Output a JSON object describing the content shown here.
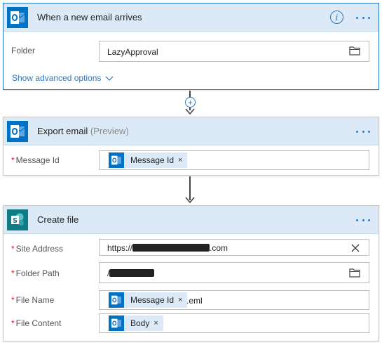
{
  "trigger": {
    "title": "When a new email arrives",
    "info_glyph": "i",
    "folder_label": "Folder",
    "folder_value": "LazyApproval",
    "advanced_label": "Show advanced options"
  },
  "connector1": {
    "plus_glyph": "+"
  },
  "export": {
    "title": "Export email",
    "preview": "(Preview)",
    "required_mark": "*",
    "message_id_label": "Message Id",
    "message_id_token": "Message Id",
    "token_remove": "×"
  },
  "create": {
    "title": "Create file",
    "required_mark": "*",
    "site_address_label": "Site Address",
    "site_address_prefix": "https://",
    "site_address_suffix": ".com",
    "folder_path_label": "Folder Path",
    "folder_path_prefix": "/",
    "file_name_label": "File Name",
    "file_name_token": "Message Id",
    "file_name_suffix": ".eml",
    "file_content_label": "File Content",
    "file_content_token": "Body",
    "token_remove": "×"
  },
  "colors": {
    "accent": "#2b79c2",
    "outlook": "#0072c6",
    "sharepoint": "#0f7b84",
    "header_bg": "#dceaf7",
    "required": "#e81123"
  },
  "icons": {
    "outlook": "outlook-icon",
    "sharepoint": "sharepoint-icon",
    "folder": "folder-icon",
    "clear": "close-icon",
    "info": "info-icon",
    "more": "more-options-icon",
    "chevron": "chevron-down-icon",
    "add": "plus-icon",
    "arrow": "arrow-down-icon"
  }
}
